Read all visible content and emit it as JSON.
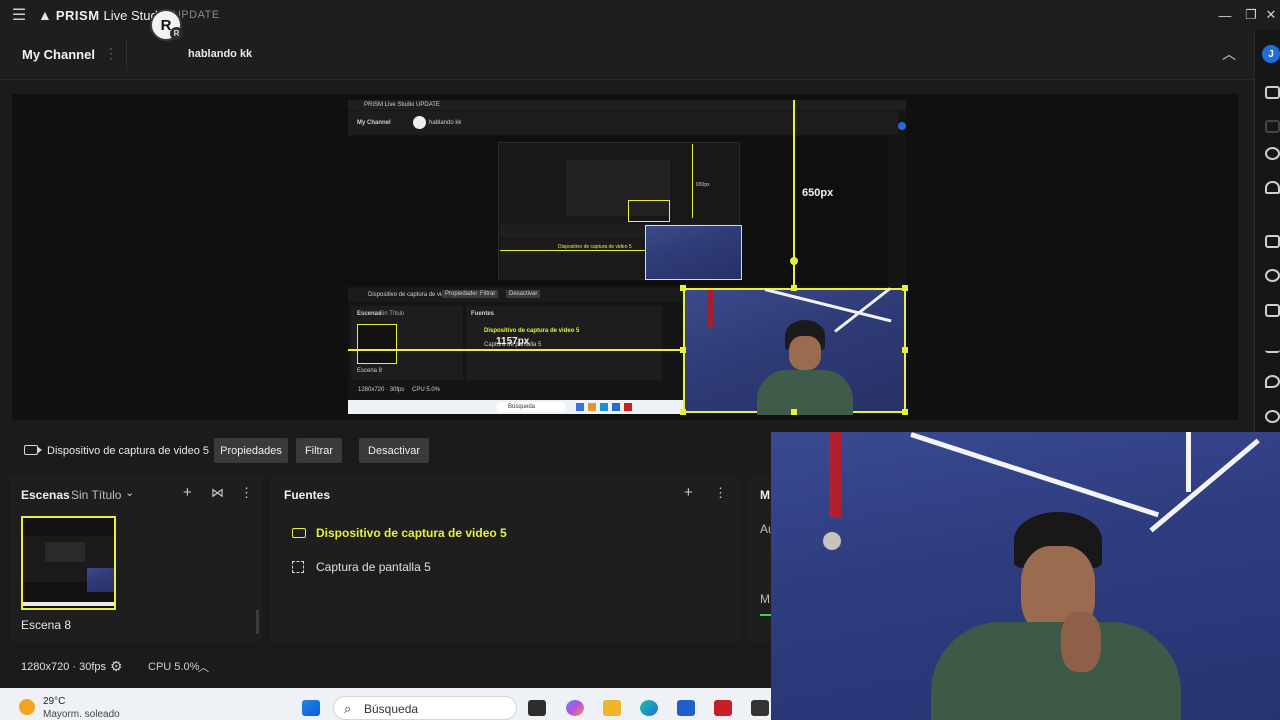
{
  "app": {
    "brand": "PRISM",
    "product": "Live Studio",
    "update_label": "UPDATE"
  },
  "channel": {
    "title": "My Channel",
    "avatar_letter": "R",
    "avatar_badge": "R",
    "name": "hablando kk",
    "profile_letter": "J"
  },
  "preview": {
    "height_label": "650px",
    "width_label": "1157px"
  },
  "source_bar": {
    "device": "Dispositivo de captura de video 5",
    "properties": "Propiedades",
    "filter": "Filtrar",
    "deactivate": "Desactivar"
  },
  "scenes": {
    "title": "Escenas",
    "collection": "Sin Título",
    "items": [
      {
        "label": "Escena 8"
      }
    ]
  },
  "sources": {
    "title": "Fuentes",
    "items": [
      {
        "label": "Dispositivo de captura de video 5"
      },
      {
        "label": "Captura de pantalla 5"
      }
    ]
  },
  "mixer": {
    "title": "M",
    "row1": "Au",
    "row2": "M"
  },
  "status": {
    "resolution": "1280x720 · 30fps",
    "cpu": "CPU 5.0%"
  },
  "taskbar": {
    "temperature": "29°C",
    "weather": "Mayorm. soleado",
    "search": "Búsqueda"
  },
  "mini": {
    "title": "PRISM Live Studio UPDATE",
    "channel": "My Channel",
    "name": "hablando kk",
    "device": "Dispositivo de captura de video 5",
    "props": "Propiedades",
    "filter": "Filtrar",
    "deactivate": "Desactivar",
    "scenes": "Escenas",
    "untitled": "Sin Título",
    "sources": "Fuentes",
    "src1": "Dispositivo de captura de video 5",
    "src2": "Captura de pantalla 5",
    "scene": "Escena 8",
    "res": "1280x720 · 30fps",
    "cpu": "CPU 5.0%",
    "search": "Búsqueda",
    "label650": "650px",
    "label1157": "1157px"
  },
  "colors": {
    "accent": "#e8f03a",
    "background": "#1b1b1b",
    "panel": "#1e1e1e",
    "profile": "#1f6fd8"
  }
}
